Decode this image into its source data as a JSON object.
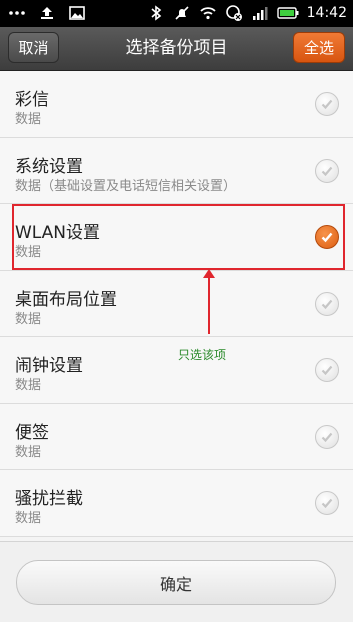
{
  "status_bar": {
    "time": "14:42",
    "left_icons": [
      "more-dots-icon",
      "upload-icon",
      "image-icon"
    ],
    "right_icons": [
      "bluetooth-icon",
      "silent-icon",
      "wifi-icon",
      "sync-icon",
      "signal-icon",
      "battery-icon"
    ]
  },
  "header": {
    "cancel_label": "取消",
    "title": "选择备份项目",
    "select_all_label": "全选"
  },
  "items": [
    {
      "name": "彩信",
      "sub": "数据",
      "checked": false
    },
    {
      "name": "系统设置",
      "sub": "数据（基础设置及电话短信相关设置）",
      "checked": false
    },
    {
      "name": "WLAN设置",
      "sub": "数据",
      "checked": true
    },
    {
      "name": "桌面布局位置",
      "sub": "数据",
      "checked": false
    },
    {
      "name": "闹钟设置",
      "sub": "数据",
      "checked": false
    },
    {
      "name": "便签",
      "sub": "数据",
      "checked": false
    },
    {
      "name": "骚扰拦截",
      "sub": "数据",
      "checked": false
    }
  ],
  "annotation": {
    "text": "只选该项"
  },
  "footer": {
    "confirm_label": "确定"
  },
  "colors": {
    "accent": "#e8661f",
    "highlight_border": "#e0262e",
    "annotation_text": "#2a8a2a"
  }
}
